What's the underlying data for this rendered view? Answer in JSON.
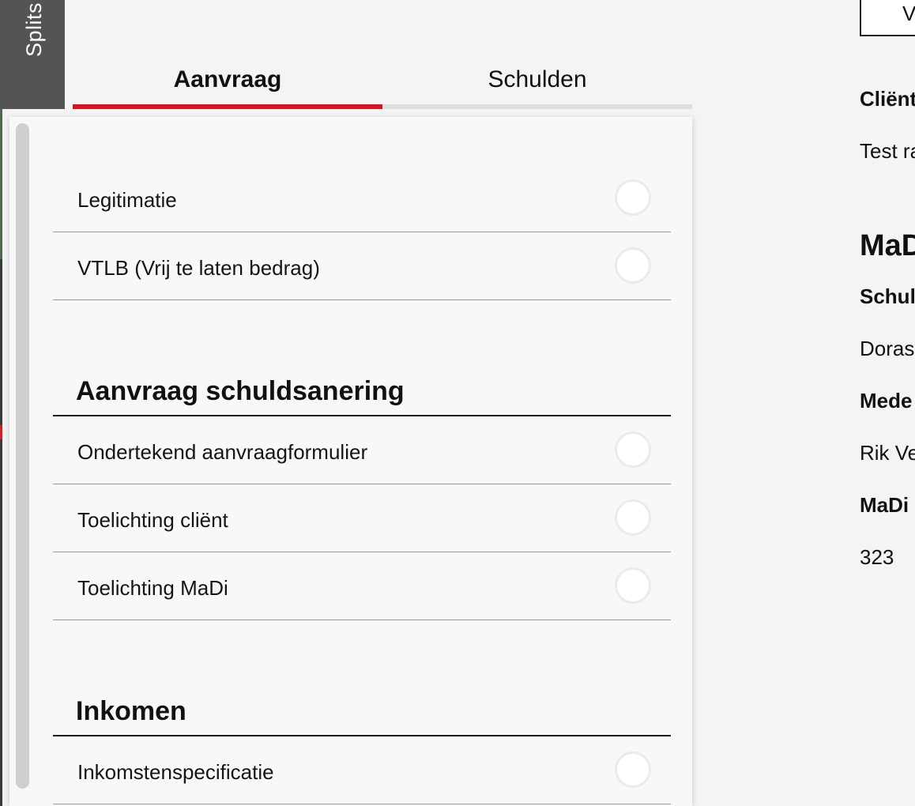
{
  "side_tab": {
    "label": "Splits"
  },
  "tabs": [
    {
      "label": "Aanvraag",
      "active": true
    },
    {
      "label": "Schulden",
      "active": false
    }
  ],
  "accent_color": "#d9141f",
  "checklist": {
    "group1": [
      {
        "label": "Legitimatie"
      },
      {
        "label": "VTLB (Vrij te laten bedrag)"
      }
    ],
    "section2": {
      "title": "Aanvraag schuldsanering",
      "items": [
        {
          "label": "Ondertekend aanvraagformulier"
        },
        {
          "label": "Toelichting cliënt"
        },
        {
          "label": "Toelichting MaDi"
        }
      ]
    },
    "section3": {
      "title": "Inkomen",
      "items": [
        {
          "label": "Inkomstenspecificatie"
        }
      ]
    }
  },
  "right_panel": {
    "top_button": "V",
    "client_label": "Cliënt",
    "client_value": "Test ra",
    "madi_heading": "MaDi",
    "schuld_label": "Schuld",
    "schuld_value": "Doras",
    "mede_label": "Mede",
    "mede_value": "Rik Ve",
    "madi_label": "MaDi",
    "madi_value": "323"
  }
}
